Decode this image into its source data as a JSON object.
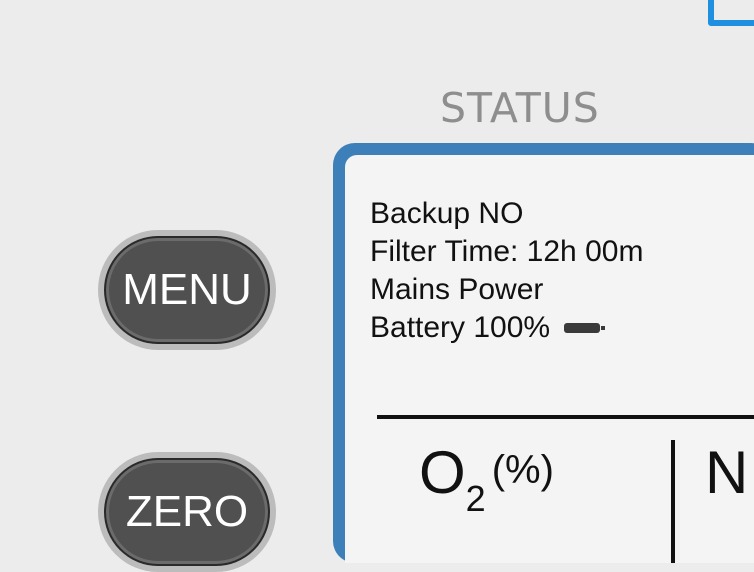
{
  "header": {
    "status_title": "STATUS"
  },
  "buttons": {
    "menu_label": "MENU",
    "zero_label": "ZERO"
  },
  "status_panel": {
    "backup": "Backup NO",
    "filter_time": "Filter Time: 12h 00m",
    "power": "Mains Power",
    "battery": "Battery 100%",
    "battery_icon": "battery-icon"
  },
  "gas_readout": {
    "main": "O",
    "subscript": "2",
    "unit": "(%)",
    "next_label_partial": "N"
  },
  "colors": {
    "frame": "#3d7fb8",
    "accent": "#1f8fe0",
    "button": "#505050",
    "background": "#ececec"
  }
}
